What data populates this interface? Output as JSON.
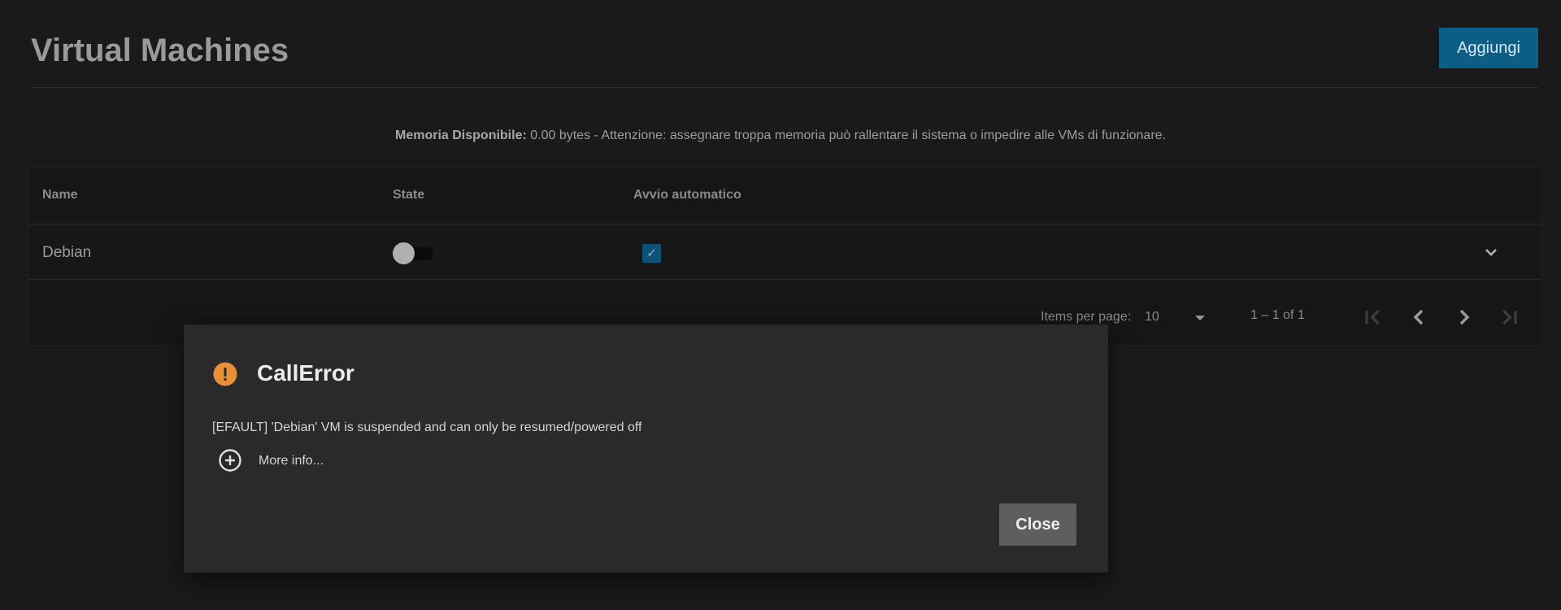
{
  "header": {
    "title": "Virtual Machines",
    "add_label": "Aggiungi"
  },
  "memory_note": {
    "label": "Memoria Disponibile:",
    "text": " 0.00 bytes - Attenzione: assegnare troppa memoria può rallentare il sistema o impedire alle VMs di funzionare."
  },
  "table": {
    "columns": [
      "Name",
      "State",
      "Avvio automatico"
    ],
    "rows": [
      {
        "name": "Debian",
        "state_on": false,
        "autostart": true
      }
    ]
  },
  "paginator": {
    "items_per_page_label": "Items per page:",
    "page_size": "10",
    "range": "1 – 1 of 1"
  },
  "dialog": {
    "title": "CallError",
    "message": "[EFAULT] 'Debian' VM is suspended and can only be resumed/powered off",
    "more_info": "More info...",
    "close_label": "Close"
  },
  "colors": {
    "accent": "#0d5e87",
    "warning": "#e8903a",
    "background": "#1a1a1b",
    "dialog": "#2a2a2b"
  },
  "icons": [
    "warning-icon",
    "plus-circle-icon",
    "chevron-down-icon",
    "first-page-icon",
    "prev-page-icon",
    "next-page-icon",
    "last-page-icon",
    "check-icon"
  ]
}
